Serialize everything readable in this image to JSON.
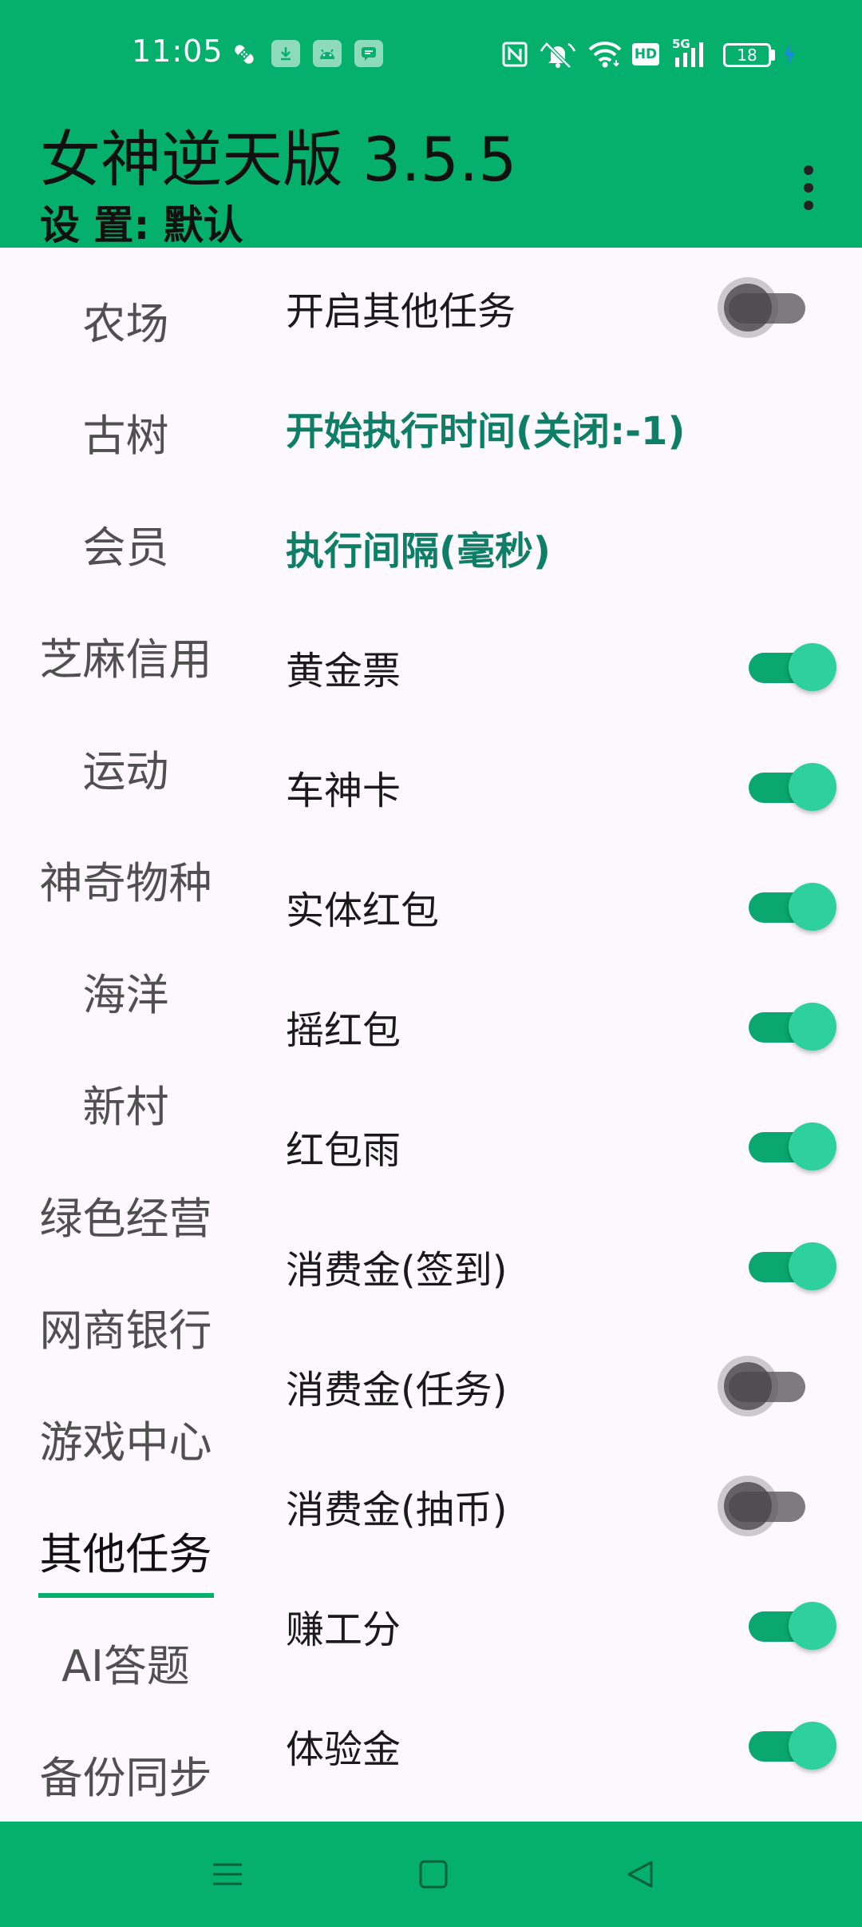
{
  "status_bar": {
    "time": "11:05",
    "hd_label": "HD",
    "network_label": "5G",
    "battery_level": "18",
    "icons": [
      "bandage-icon",
      "download-icon",
      "android-icon",
      "message-icon",
      "nfc-icon",
      "bell-muted-icon",
      "wifi-icon",
      "hd-icon",
      "signal-5g-icon",
      "battery-icon",
      "charging-icon"
    ]
  },
  "app_bar": {
    "title": "女神逆天版 3.5.5",
    "subtitle": "设 置: 默认",
    "menu_icon": "more-vert-icon"
  },
  "sidebar": {
    "items": [
      {
        "label": "农场"
      },
      {
        "label": "古树"
      },
      {
        "label": "会员"
      },
      {
        "label": "芝麻信用"
      },
      {
        "label": "运动"
      },
      {
        "label": "神奇物种"
      },
      {
        "label": "海洋"
      },
      {
        "label": "新村"
      },
      {
        "label": "绿色经营"
      },
      {
        "label": "网商银行"
      },
      {
        "label": "游戏中心"
      },
      {
        "label": "其他任务"
      },
      {
        "label": "AI答题"
      },
      {
        "label": "备份同步"
      }
    ],
    "selected": "其他任务"
  },
  "settings": {
    "rows": [
      {
        "label": "开启其他任务",
        "type": "switch",
        "checked": false
      },
      {
        "label": "开始执行时间(关闭:-1)",
        "type": "section"
      },
      {
        "label": "执行间隔(毫秒)",
        "type": "section"
      },
      {
        "label": "黄金票",
        "type": "switch",
        "checked": true
      },
      {
        "label": "车神卡",
        "type": "switch",
        "checked": true
      },
      {
        "label": "实体红包",
        "type": "switch",
        "checked": true
      },
      {
        "label": "摇红包",
        "type": "switch",
        "checked": true
      },
      {
        "label": "红包雨",
        "type": "switch",
        "checked": true
      },
      {
        "label": "消费金(签到)",
        "type": "switch",
        "checked": true
      },
      {
        "label": "消费金(任务)",
        "type": "switch",
        "checked": false
      },
      {
        "label": "消费金(抽币)",
        "type": "switch",
        "checked": false
      },
      {
        "label": "赚工分",
        "type": "switch",
        "checked": true
      },
      {
        "label": "体验金",
        "type": "switch",
        "checked": true
      }
    ]
  },
  "nav_bar": {
    "icons": [
      "menu-icon",
      "home-square-icon",
      "back-triangle-icon"
    ]
  },
  "colors": {
    "primary": "#05b06c",
    "section_text": "#0e7f66",
    "switch_on_thumb": "#2ed19c",
    "switch_on_track": "#0aa770",
    "switch_off_thumb": "#4a474c",
    "background": "#fdf8fd"
  }
}
